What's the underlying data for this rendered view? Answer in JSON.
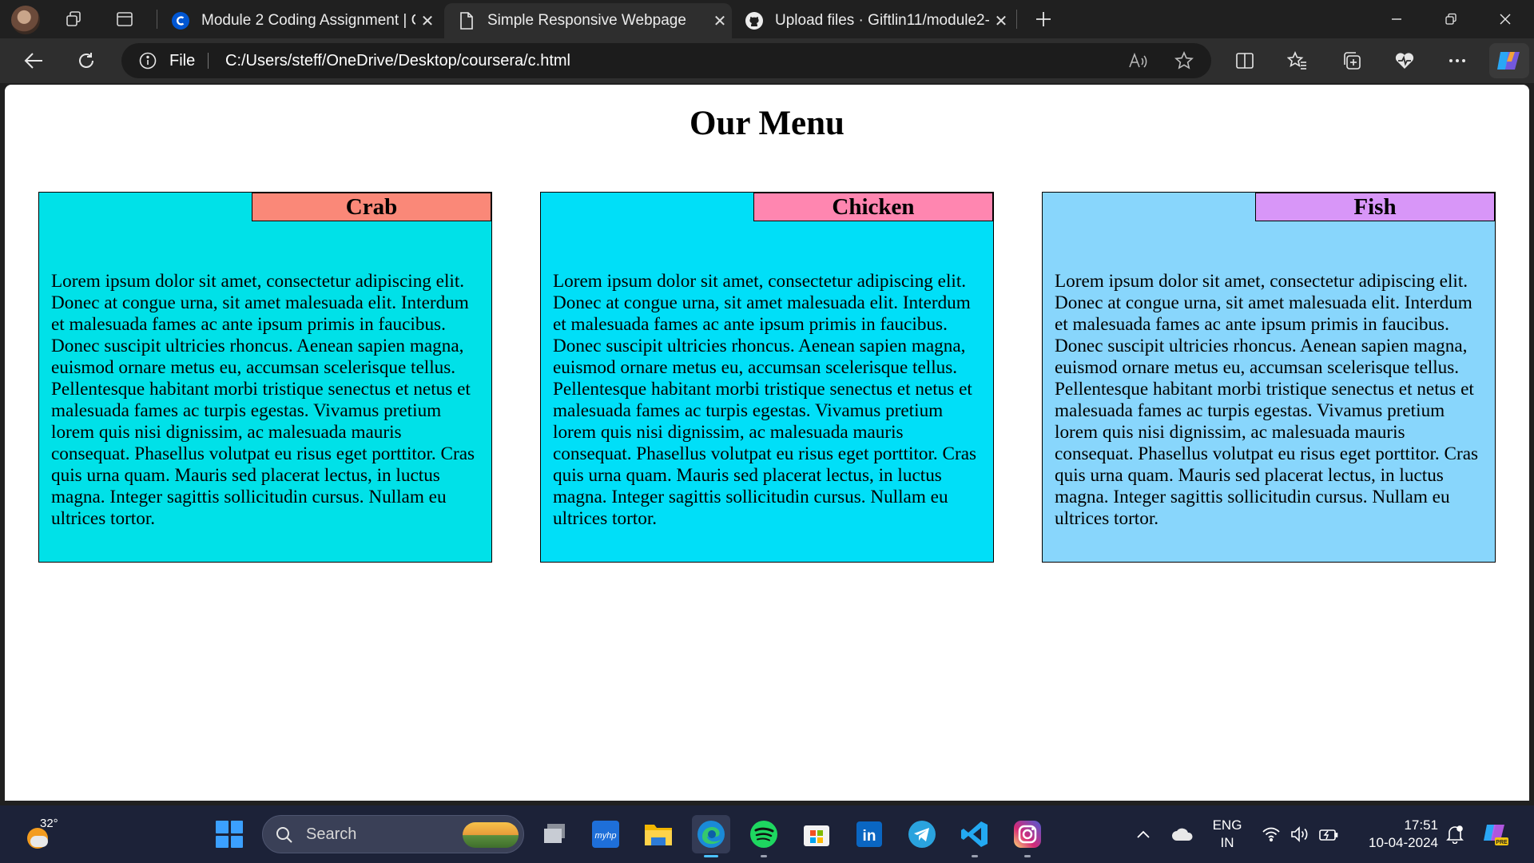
{
  "browser": {
    "tabs": [
      {
        "label": "Module 2 Coding Assignment | C",
        "favicon": "coursera-icon",
        "active": false
      },
      {
        "label": "Simple Responsive Webpage",
        "favicon": "page-icon",
        "active": true
      },
      {
        "label": "Upload files · Giftlin11/module2-",
        "favicon": "github-icon",
        "active": false
      }
    ],
    "address": {
      "scheme_label": "File",
      "url": "C:/Users/steff/OneDrive/Desktop/coursera/c.html"
    }
  },
  "page": {
    "title": "Our Menu",
    "cards": [
      {
        "name": "Crab",
        "box_color": "#00e1e8",
        "badge_color": "#fa8878",
        "text": "Lorem ipsum dolor sit amet, consectetur adipiscing elit. Donec at congue urna, sit amet malesuada elit. Interdum et malesuada fames ac ante ipsum primis in faucibus. Donec suscipit ultricies rhoncus. Aenean sapien magna, euismod ornare metus eu, accumsan scelerisque tellus. Pellentesque habitant morbi tristique senectus et netus et malesuada fames ac turpis egestas. Vivamus pretium lorem quis nisi dignissim, ac malesuada mauris consequat. Phasellus volutpat eu risus eget porttitor. Cras quis urna quam. Mauris sed placerat lectus, in luctus magna. Integer sagittis sollicitudin cursus. Nullam eu ultrices tortor."
      },
      {
        "name": "Chicken",
        "box_color": "#00dff8",
        "badge_color": "#ff86b0",
        "text": "Lorem ipsum dolor sit amet, consectetur adipiscing elit. Donec at congue urna, sit amet malesuada elit. Interdum et malesuada fames ac ante ipsum primis in faucibus. Donec suscipit ultricies rhoncus. Aenean sapien magna, euismod ornare metus eu, accumsan scelerisque tellus. Pellentesque habitant morbi tristique senectus et netus et malesuada fames ac turpis egestas. Vivamus pretium lorem quis nisi dignissim, ac malesuada mauris consequat. Phasellus volutpat eu risus eget porttitor. Cras quis urna quam. Mauris sed placerat lectus, in luctus magna. Integer sagittis sollicitudin cursus. Nullam eu ultrices tortor."
      },
      {
        "name": "Fish",
        "box_color": "#88d6fc",
        "badge_color": "#d896f8",
        "text": "Lorem ipsum dolor sit amet, consectetur adipiscing elit. Donec at congue urna, sit amet malesuada elit. Interdum et malesuada fames ac ante ipsum primis in faucibus. Donec suscipit ultricies rhoncus. Aenean sapien magna, euismod ornare metus eu, accumsan scelerisque tellus. Pellentesque habitant morbi tristique senectus et netus et malesuada fames ac turpis egestas. Vivamus pretium lorem quis nisi dignissim, ac malesuada mauris consequat. Phasellus volutpat eu risus eget porttitor. Cras quis urna quam. Mauris sed placerat lectus, in luctus magna. Integer sagittis sollicitudin cursus. Nullam eu ultrices tortor."
      }
    ]
  },
  "taskbar": {
    "weather_temp": "32°",
    "search_placeholder": "Search",
    "apps": [
      "file-stack-icon",
      "myhp-icon",
      "file-explorer-icon",
      "edge-icon",
      "spotify-icon",
      "microsoft-store-icon",
      "linkedin-icon",
      "telegram-icon",
      "vscode-icon",
      "instagram-icon"
    ],
    "language": {
      "line1": "ENG",
      "line2": "IN"
    },
    "clock": {
      "time": "17:51",
      "date": "10-04-2024"
    }
  }
}
